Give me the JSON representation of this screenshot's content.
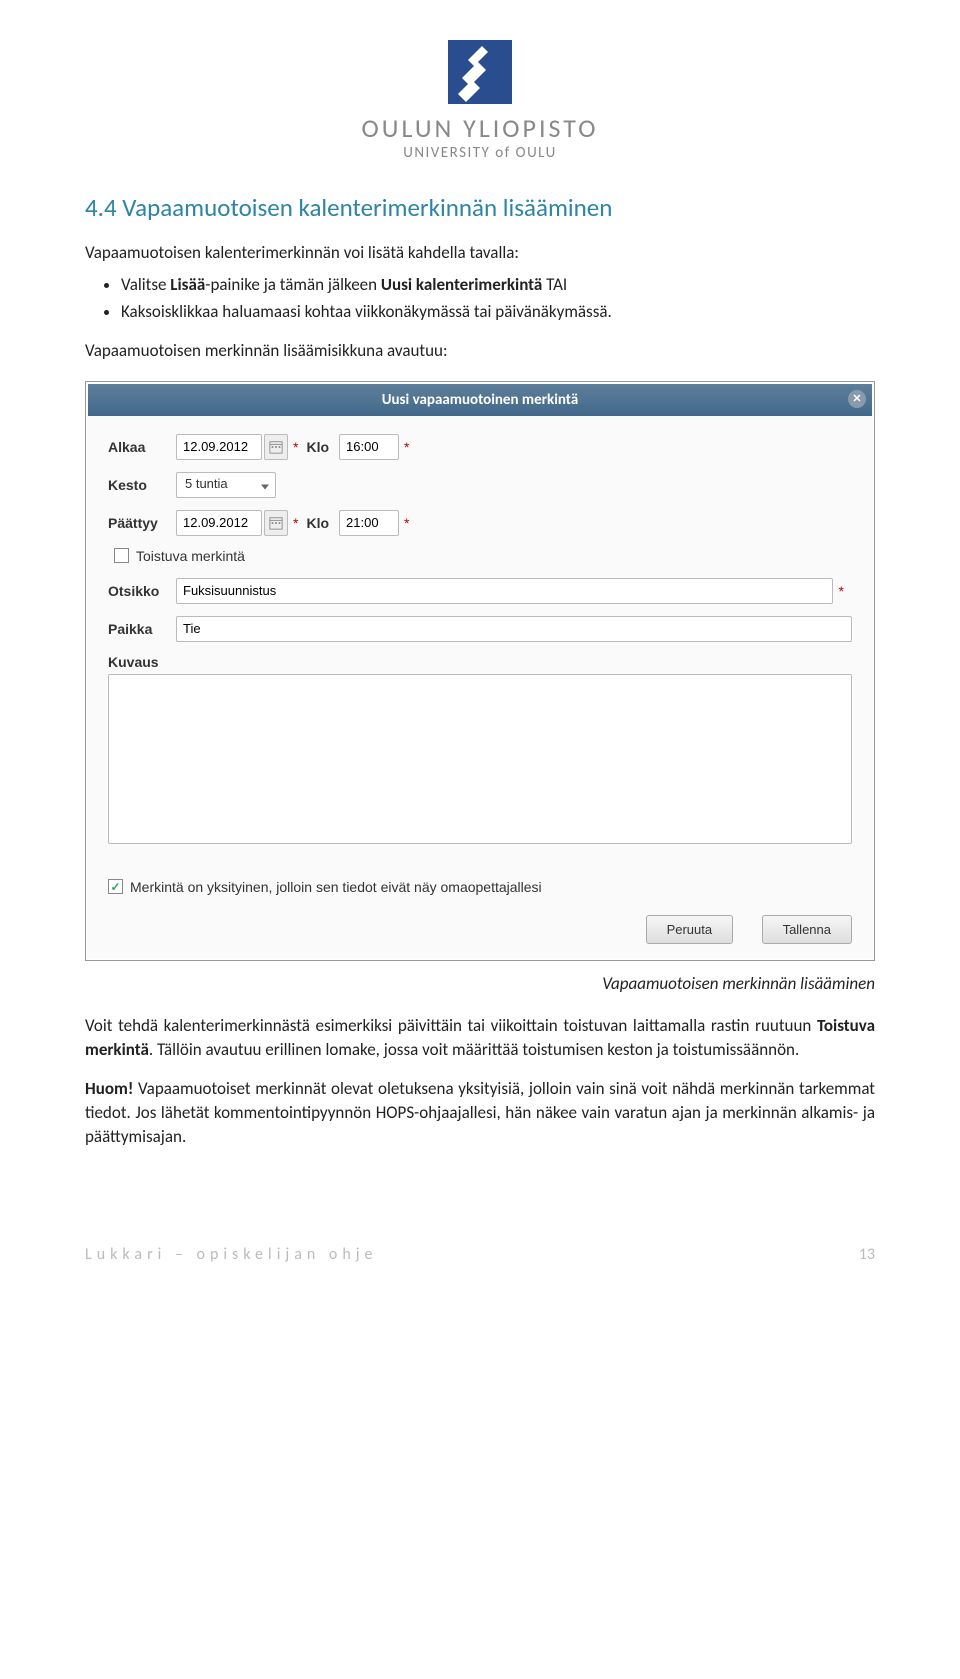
{
  "logo": {
    "line1": "OULUN YLIOPISTO",
    "line2": "UNIVERSITY of OULU"
  },
  "section": {
    "heading": "4.4 Vapaamuotoisen kalenterimerkinnän lisääminen",
    "intro": "Vapaamuotoisen kalenterimerkinnän voi lisätä kahdella tavalla:",
    "bullets": [
      {
        "pre": "Valitse ",
        "bold1": "Lisää",
        "mid": "-painike ja tämän jälkeen ",
        "bold2": "Uusi kalenterimerkintä",
        "post": " TAI"
      },
      {
        "pre": "Kaksoisklikkaa haluamaasi kohtaa viikkonäkymässä tai päivänäkymässä.",
        "bold1": "",
        "mid": "",
        "bold2": "",
        "post": ""
      }
    ],
    "dialog_intro": "Vapaamuotoisen merkinnän lisäämisikkuna avautuu:"
  },
  "dialog": {
    "title": "Uusi vapaamuotoinen merkintä",
    "labels": {
      "alkaa": "Alkaa",
      "klo": "Klo",
      "kesto": "Kesto",
      "paattyy": "Päättyy",
      "toistuva": "Toistuva merkintä",
      "otsikko": "Otsikko",
      "paikka": "Paikka",
      "kuvaus": "Kuvaus",
      "privacy": "Merkintä on yksityinen, jolloin sen tiedot eivät näy omaopettajallesi"
    },
    "values": {
      "alkaa_date": "12.09.2012",
      "alkaa_time": "16:00",
      "kesto": "5 tuntia",
      "paattyy_date": "12.09.2012",
      "paattyy_time": "21:00",
      "otsikko": "Fuksisuunnistus",
      "paikka": "Tie",
      "kuvaus": ""
    },
    "buttons": {
      "peruuta": "Peruuta",
      "tallenna": "Tallenna"
    }
  },
  "caption": "Vapaamuotoisen merkinnän lisääminen",
  "para1": {
    "pre": "Voit tehdä kalenterimerkinnästä esimerkiksi päivittäin tai viikoittain toistuvan laittamalla rastin ruutuun ",
    "bold": "Toistuva merkintä",
    "post": ". Tällöin avautuu erillinen lomake, jossa voit määrittää toistumisen keston ja toistumissäännön."
  },
  "para2": {
    "bold": "Huom!",
    "post": " Vapaamuotoiset merkinnät olevat oletuksena yksityisiä, jolloin vain sinä voit nähdä merkinnän tarkemmat tiedot. Jos lähetät kommentointipyynnön HOPS-ohjaajallesi, hän näkee vain varatun ajan ja merkinnän alkamis- ja päättymisajan."
  },
  "footer": {
    "left": "Lukkari – opiskelijan ohje",
    "right": "13"
  }
}
